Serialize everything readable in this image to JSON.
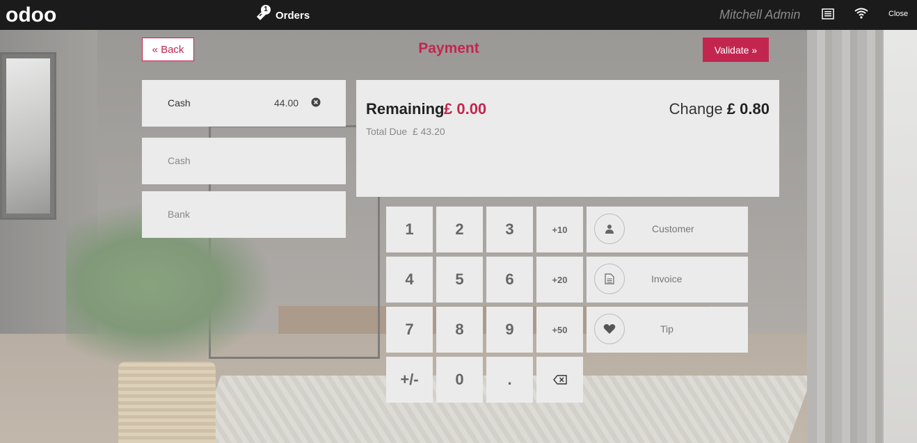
{
  "topbar": {
    "logo": "odoo",
    "orders_label": "Orders",
    "orders_count": "1",
    "cashier": "Mitchell Admin",
    "close_label": "Close"
  },
  "header": {
    "back_label": "« Back",
    "title": "Payment",
    "validate_label": "Validate »"
  },
  "payment_lines": [
    {
      "method": "Cash",
      "amount": "44.00"
    }
  ],
  "payment_methods": [
    "Cash",
    "Bank"
  ],
  "summary": {
    "remaining_label": "Remaining",
    "remaining_value": "£ 0.00",
    "change_label": "Change",
    "change_value": "£ 0.80",
    "total_due_label": "Total Due",
    "total_due_value": "£ 43.20"
  },
  "numpad": {
    "keys": [
      "1",
      "2",
      "3",
      "+10",
      "4",
      "5",
      "6",
      "+20",
      "7",
      "8",
      "9",
      "+50",
      "+/-",
      "0",
      "."
    ],
    "backspace_icon": "backspace-icon"
  },
  "side_buttons": {
    "customer_label": "Customer",
    "invoice_label": "Invoice",
    "tip_label": "Tip"
  },
  "colors": {
    "accent": "#c2264f",
    "topbar": "#1b1b1b",
    "panel": "#ebebeb"
  }
}
